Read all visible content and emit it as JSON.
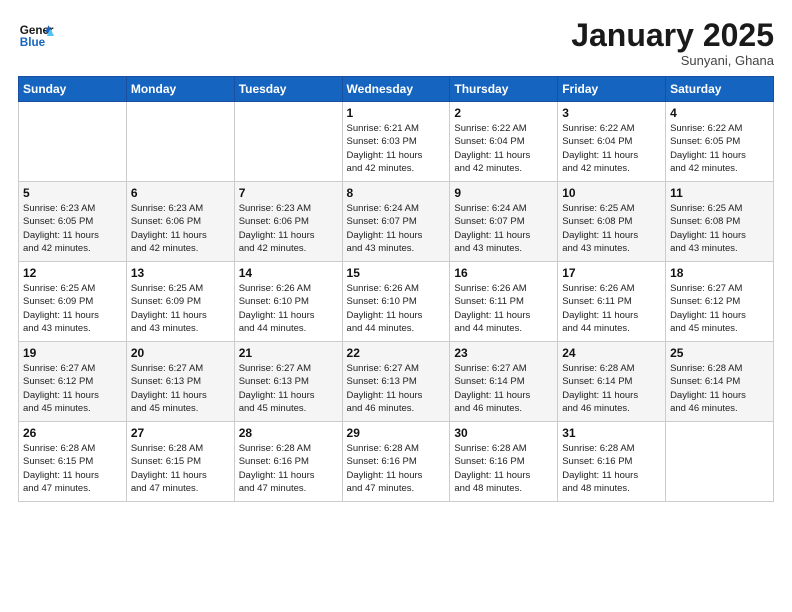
{
  "logo": {
    "line1": "General",
    "line2": "Blue"
  },
  "title": "January 2025",
  "subtitle": "Sunyani, Ghana",
  "days_of_week": [
    "Sunday",
    "Monday",
    "Tuesday",
    "Wednesday",
    "Thursday",
    "Friday",
    "Saturday"
  ],
  "weeks": [
    [
      {
        "day": "",
        "detail": ""
      },
      {
        "day": "",
        "detail": ""
      },
      {
        "day": "",
        "detail": ""
      },
      {
        "day": "1",
        "detail": "Sunrise: 6:21 AM\nSunset: 6:03 PM\nDaylight: 11 hours\nand 42 minutes."
      },
      {
        "day": "2",
        "detail": "Sunrise: 6:22 AM\nSunset: 6:04 PM\nDaylight: 11 hours\nand 42 minutes."
      },
      {
        "day": "3",
        "detail": "Sunrise: 6:22 AM\nSunset: 6:04 PM\nDaylight: 11 hours\nand 42 minutes."
      },
      {
        "day": "4",
        "detail": "Sunrise: 6:22 AM\nSunset: 6:05 PM\nDaylight: 11 hours\nand 42 minutes."
      }
    ],
    [
      {
        "day": "5",
        "detail": "Sunrise: 6:23 AM\nSunset: 6:05 PM\nDaylight: 11 hours\nand 42 minutes."
      },
      {
        "day": "6",
        "detail": "Sunrise: 6:23 AM\nSunset: 6:06 PM\nDaylight: 11 hours\nand 42 minutes."
      },
      {
        "day": "7",
        "detail": "Sunrise: 6:23 AM\nSunset: 6:06 PM\nDaylight: 11 hours\nand 42 minutes."
      },
      {
        "day": "8",
        "detail": "Sunrise: 6:24 AM\nSunset: 6:07 PM\nDaylight: 11 hours\nand 43 minutes."
      },
      {
        "day": "9",
        "detail": "Sunrise: 6:24 AM\nSunset: 6:07 PM\nDaylight: 11 hours\nand 43 minutes."
      },
      {
        "day": "10",
        "detail": "Sunrise: 6:25 AM\nSunset: 6:08 PM\nDaylight: 11 hours\nand 43 minutes."
      },
      {
        "day": "11",
        "detail": "Sunrise: 6:25 AM\nSunset: 6:08 PM\nDaylight: 11 hours\nand 43 minutes."
      }
    ],
    [
      {
        "day": "12",
        "detail": "Sunrise: 6:25 AM\nSunset: 6:09 PM\nDaylight: 11 hours\nand 43 minutes."
      },
      {
        "day": "13",
        "detail": "Sunrise: 6:25 AM\nSunset: 6:09 PM\nDaylight: 11 hours\nand 43 minutes."
      },
      {
        "day": "14",
        "detail": "Sunrise: 6:26 AM\nSunset: 6:10 PM\nDaylight: 11 hours\nand 44 minutes."
      },
      {
        "day": "15",
        "detail": "Sunrise: 6:26 AM\nSunset: 6:10 PM\nDaylight: 11 hours\nand 44 minutes."
      },
      {
        "day": "16",
        "detail": "Sunrise: 6:26 AM\nSunset: 6:11 PM\nDaylight: 11 hours\nand 44 minutes."
      },
      {
        "day": "17",
        "detail": "Sunrise: 6:26 AM\nSunset: 6:11 PM\nDaylight: 11 hours\nand 44 minutes."
      },
      {
        "day": "18",
        "detail": "Sunrise: 6:27 AM\nSunset: 6:12 PM\nDaylight: 11 hours\nand 45 minutes."
      }
    ],
    [
      {
        "day": "19",
        "detail": "Sunrise: 6:27 AM\nSunset: 6:12 PM\nDaylight: 11 hours\nand 45 minutes."
      },
      {
        "day": "20",
        "detail": "Sunrise: 6:27 AM\nSunset: 6:13 PM\nDaylight: 11 hours\nand 45 minutes."
      },
      {
        "day": "21",
        "detail": "Sunrise: 6:27 AM\nSunset: 6:13 PM\nDaylight: 11 hours\nand 45 minutes."
      },
      {
        "day": "22",
        "detail": "Sunrise: 6:27 AM\nSunset: 6:13 PM\nDaylight: 11 hours\nand 46 minutes."
      },
      {
        "day": "23",
        "detail": "Sunrise: 6:27 AM\nSunset: 6:14 PM\nDaylight: 11 hours\nand 46 minutes."
      },
      {
        "day": "24",
        "detail": "Sunrise: 6:28 AM\nSunset: 6:14 PM\nDaylight: 11 hours\nand 46 minutes."
      },
      {
        "day": "25",
        "detail": "Sunrise: 6:28 AM\nSunset: 6:14 PM\nDaylight: 11 hours\nand 46 minutes."
      }
    ],
    [
      {
        "day": "26",
        "detail": "Sunrise: 6:28 AM\nSunset: 6:15 PM\nDaylight: 11 hours\nand 47 minutes."
      },
      {
        "day": "27",
        "detail": "Sunrise: 6:28 AM\nSunset: 6:15 PM\nDaylight: 11 hours\nand 47 minutes."
      },
      {
        "day": "28",
        "detail": "Sunrise: 6:28 AM\nSunset: 6:16 PM\nDaylight: 11 hours\nand 47 minutes."
      },
      {
        "day": "29",
        "detail": "Sunrise: 6:28 AM\nSunset: 6:16 PM\nDaylight: 11 hours\nand 47 minutes."
      },
      {
        "day": "30",
        "detail": "Sunrise: 6:28 AM\nSunset: 6:16 PM\nDaylight: 11 hours\nand 48 minutes."
      },
      {
        "day": "31",
        "detail": "Sunrise: 6:28 AM\nSunset: 6:16 PM\nDaylight: 11 hours\nand 48 minutes."
      },
      {
        "day": "",
        "detail": ""
      }
    ]
  ]
}
